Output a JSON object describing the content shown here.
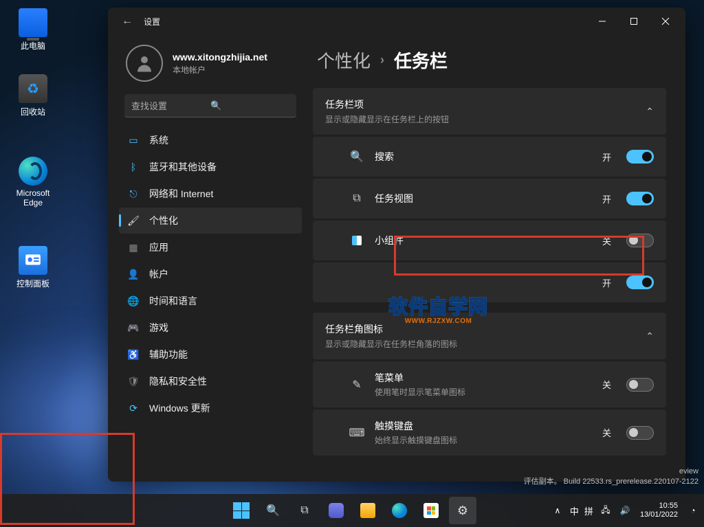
{
  "desktop_icons": {
    "pc": "此电脑",
    "bin": "回收站",
    "edge": "Microsoft Edge",
    "ctrl": "控制面板"
  },
  "window": {
    "title": "设置",
    "profile": {
      "name": "www.xitongzhijia.net",
      "account": "本地帐户"
    },
    "search_placeholder": "查找设置"
  },
  "nav": {
    "system": "系统",
    "bluetooth": "蓝牙和其他设备",
    "network": "网络和 Internet",
    "personal": "个性化",
    "apps": "应用",
    "accounts": "帐户",
    "time": "时间和语言",
    "gaming": "游戏",
    "access": "辅助功能",
    "privacy": "隐私和安全性",
    "update": "Windows 更新"
  },
  "crumb": {
    "parent": "个性化",
    "current": "任务栏"
  },
  "section1": {
    "title": "任务栏项",
    "sub": "显示或隐藏显示在任务栏上的按钮"
  },
  "opts": {
    "search": {
      "label": "搜索",
      "state": "开"
    },
    "taskview": {
      "label": "任务视图",
      "state": "开"
    },
    "widgets": {
      "label": "小组件",
      "state": "关"
    },
    "chat": {
      "label": "",
      "state": "开"
    }
  },
  "section2": {
    "title": "任务栏角图标",
    "sub": "显示或隐藏显示在任务栏角落的图标"
  },
  "corner": {
    "pen": {
      "label": "笔菜单",
      "sub": "使用笔时显示笔菜单图标",
      "state": "关"
    },
    "touch": {
      "label": "触摸键盘",
      "sub": "始终显示触摸键盘图标",
      "state": "关"
    }
  },
  "watermark": {
    "line1": "软件自学网",
    "line2": "WWW.RJZXW.COM"
  },
  "build": {
    "l1": "eview",
    "l2": "评估副本。 Build 22533.rs_prerelease.220107-2122"
  },
  "tray": {
    "ime1": "中",
    "ime2": "拼",
    "time": "10:55",
    "date": "13/01/2022",
    "chevron": "∧"
  }
}
